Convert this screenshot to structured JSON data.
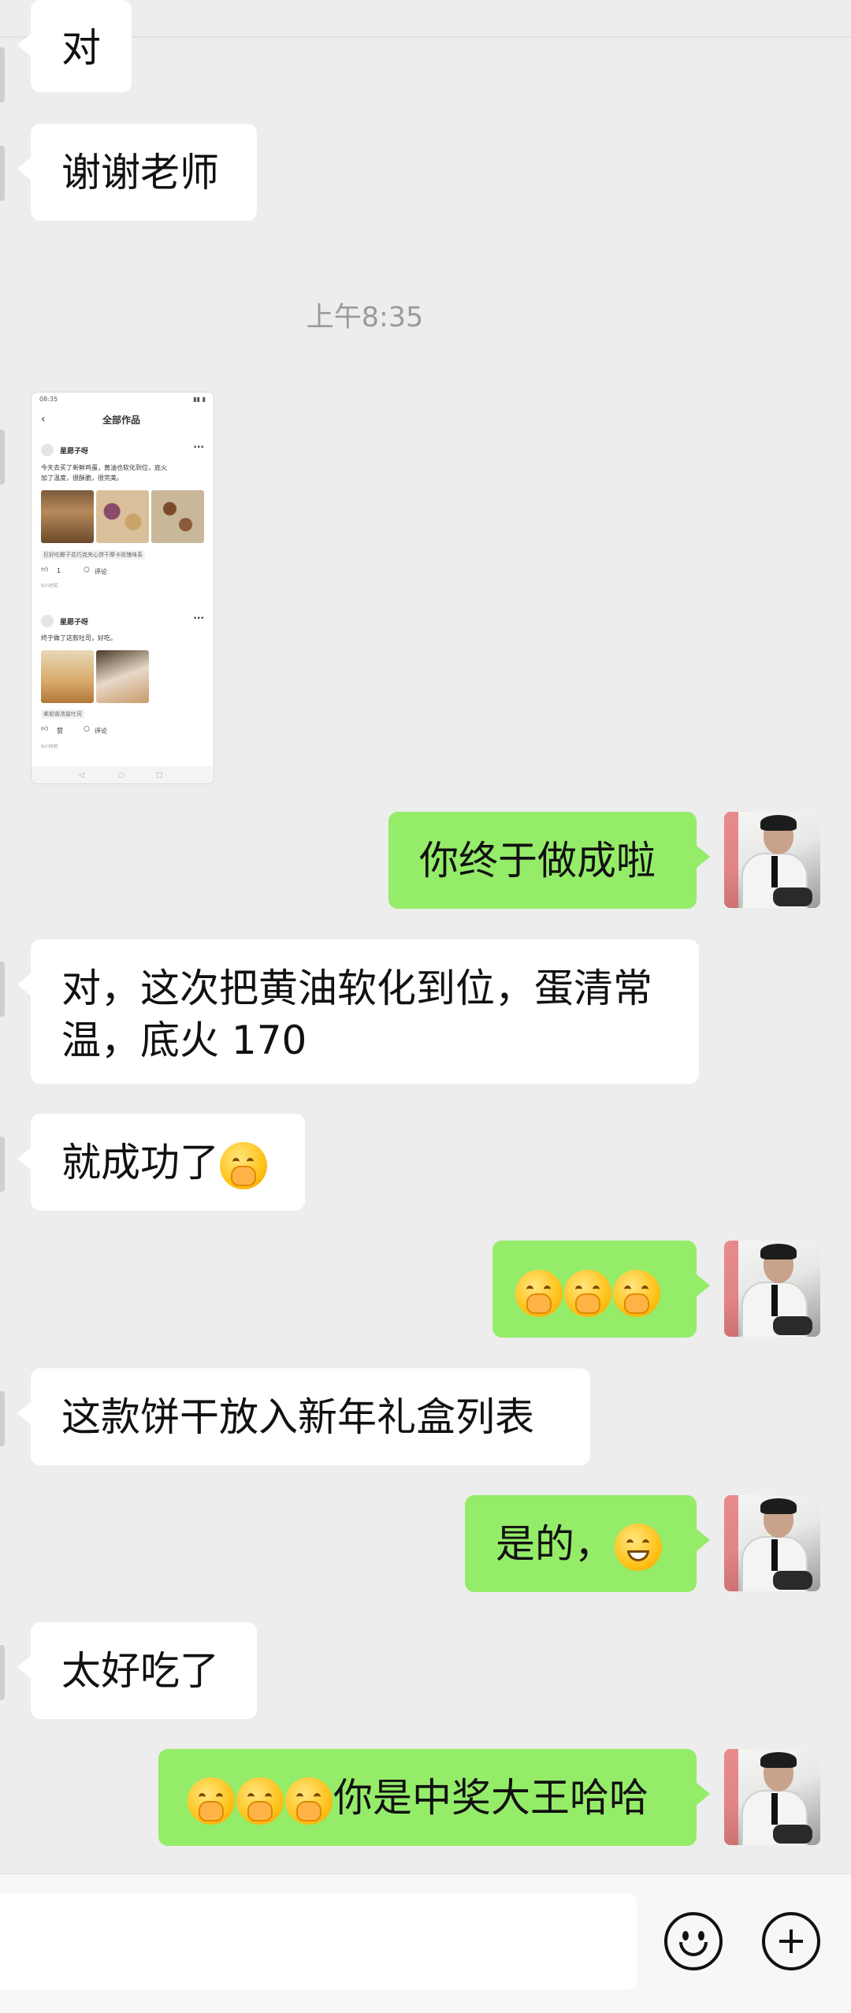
{
  "timestamp": "上午8:35",
  "screenshot_thumb": {
    "status_time": "08:35",
    "title": "全部作品",
    "post1": {
      "user": "星愿子呀",
      "text_line1": "今天去买了新鲜鸡蛋，黄油也软化到位，底火",
      "text_line2": "加了温度，很酥脆，很完美。",
      "tag": "巨好吃椰子花巧克夹心饼干摩卡玫瑰味系",
      "likes": "1",
      "comment": "评论",
      "time": "9小时前"
    },
    "post2": {
      "user": "星愿子呀",
      "text_line1": "终于做了这款吐司，好吃。",
      "tag": "柔软香浓盐吐司",
      "likes": "赞",
      "comment": "评论",
      "time": "9小时前"
    }
  },
  "messages": {
    "m1": "对",
    "m2": "谢谢老师",
    "m3": "你终于做成啦",
    "m4_line1": "对，这次把黄油软化到位，蛋清常",
    "m4_line2": "温，底火 170",
    "m5": "就成功了",
    "m7": "这款饼干放入新年礼盒列表",
    "m8": "是的，",
    "m9": "太好吃了",
    "m10": "你是中奖大王哈哈"
  },
  "icons": {
    "emoji_shush": "shushing-face-emoji",
    "emoji_grin": "grinning-face-emoji",
    "emoji_thinking": "thinking-face-emoji",
    "input_emoji": "smiley-icon",
    "input_plus": "plus-icon"
  },
  "colors": {
    "incoming_bubble": "#ffffff",
    "outgoing_bubble": "#95ec69",
    "background": "#ededed"
  }
}
